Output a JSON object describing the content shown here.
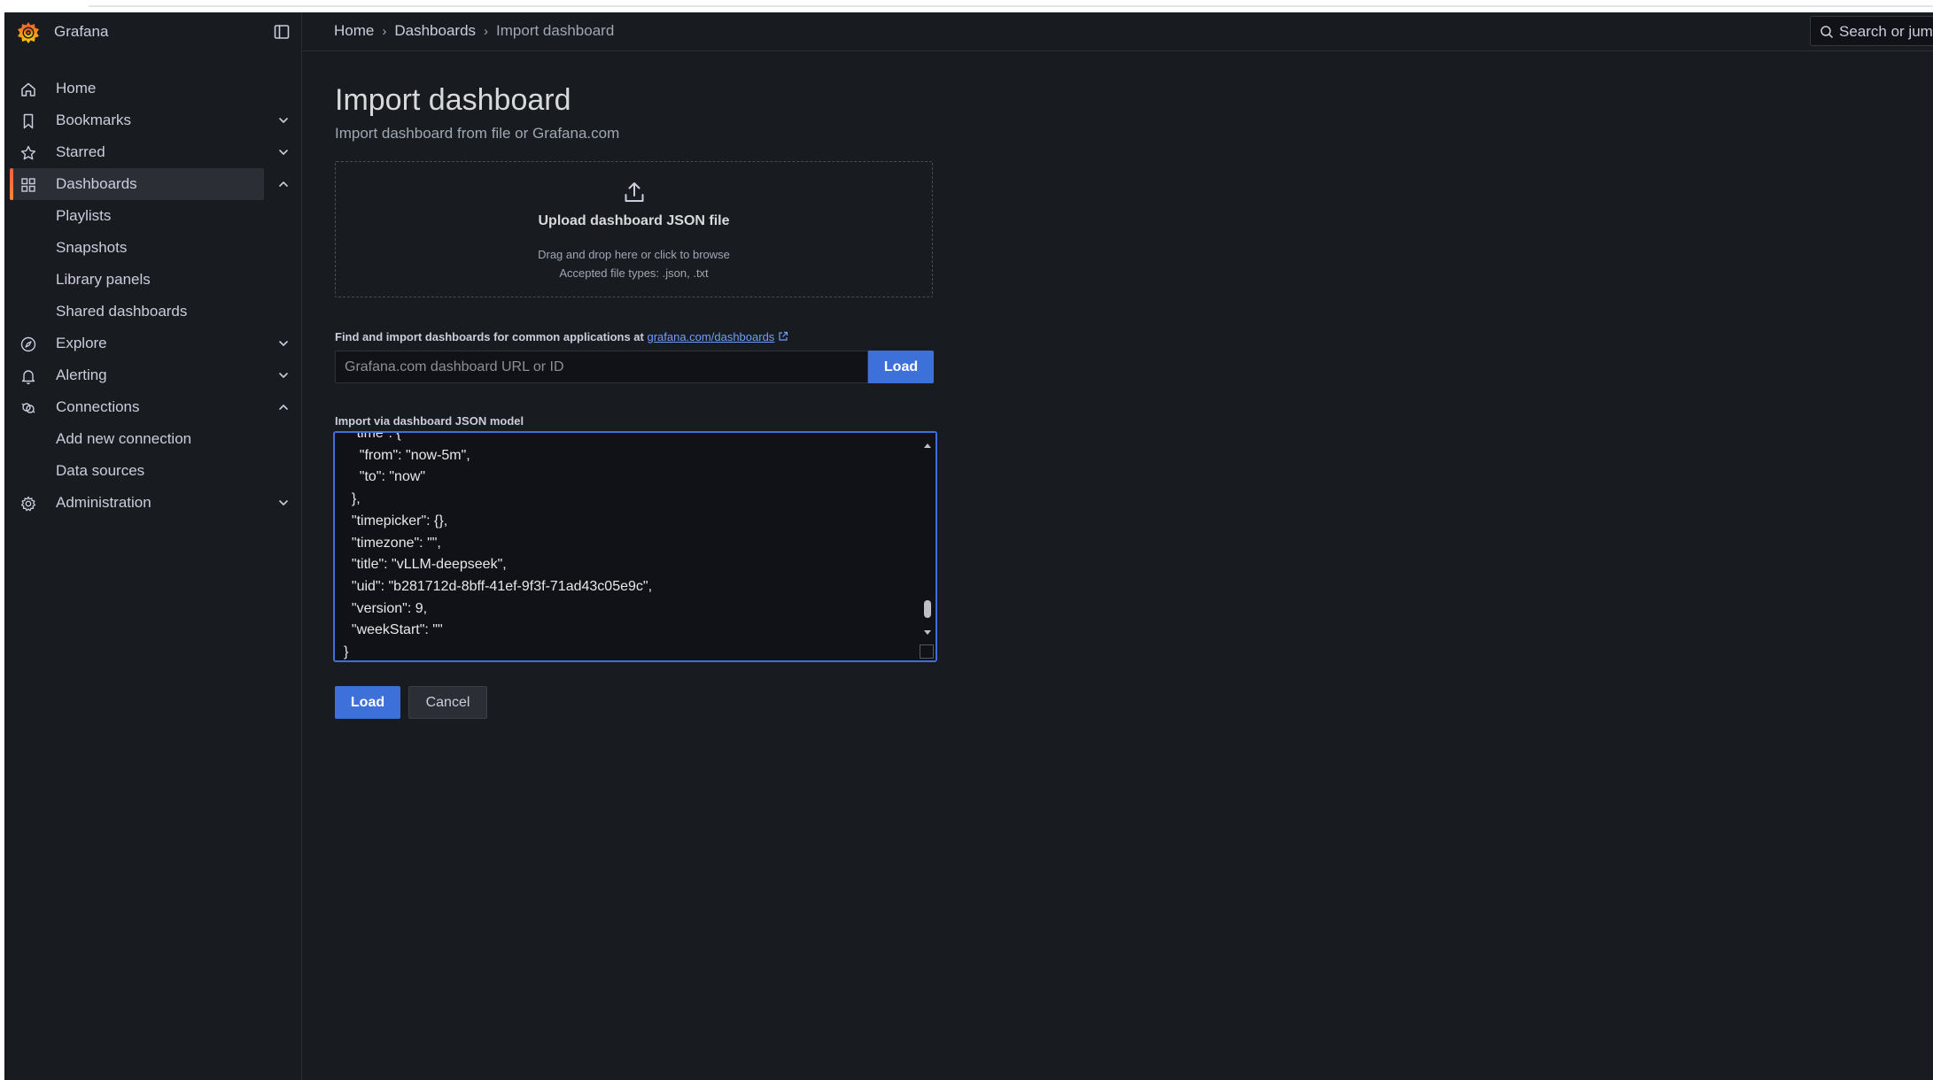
{
  "app": {
    "name": "Grafana"
  },
  "sidebar": {
    "items": [
      {
        "label": "Home",
        "icon": "home-icon",
        "chevron": ""
      },
      {
        "label": "Bookmarks",
        "icon": "bookmark-icon",
        "chevron": "down"
      },
      {
        "label": "Starred",
        "icon": "star-icon",
        "chevron": "down"
      },
      {
        "label": "Dashboards",
        "icon": "apps-icon",
        "chevron": "up",
        "active": true
      },
      {
        "label": "Playlists",
        "sub": true
      },
      {
        "label": "Snapshots",
        "sub": true
      },
      {
        "label": "Library panels",
        "sub": true
      },
      {
        "label": "Shared dashboards",
        "sub": true
      },
      {
        "label": "Explore",
        "icon": "compass-icon",
        "chevron": "down"
      },
      {
        "label": "Alerting",
        "icon": "bell-icon",
        "chevron": "down"
      },
      {
        "label": "Connections",
        "icon": "link-icon",
        "chevron": "up"
      },
      {
        "label": "Add new connection",
        "sub": true
      },
      {
        "label": "Data sources",
        "sub": true
      },
      {
        "label": "Administration",
        "icon": "cog-icon",
        "chevron": "down"
      }
    ]
  },
  "breadcrumb": {
    "items": [
      "Home",
      "Dashboards",
      "Import dashboard"
    ]
  },
  "search": {
    "text": "Search or jump to..."
  },
  "page": {
    "title": "Import dashboard",
    "subtitle": "Import dashboard from file or Grafana.com"
  },
  "upload": {
    "title": "Upload dashboard JSON file",
    "hint": "Drag and drop here or click to browse",
    "types": "Accepted file types: .json, .txt"
  },
  "grafana_com": {
    "label": "Find and import dashboards for common applications at ",
    "link_text": "grafana.com/dashboards",
    "input_placeholder": "Grafana.com dashboard URL or ID",
    "input_value": "",
    "load_label": "Load"
  },
  "json_model": {
    "label": "Import via dashboard JSON model",
    "content": "  \"time\": {\n    \"from\": \"now-5m\",\n    \"to\": \"now\"\n  },\n  \"timepicker\": {},\n  \"timezone\": \"\",\n  \"title\": \"vLLM-deepseek\",\n  \"uid\": \"b281712d-8bff-41ef-9f3f-71ad43c05e9c\",\n  \"version\": 9,\n  \"weekStart\": \"\"\n}"
  },
  "actions": {
    "load_label": "Load",
    "cancel_label": "Cancel"
  },
  "colors": {
    "primary": "#3d71d9",
    "accent": "#f55f3e",
    "background": "#181b1f"
  }
}
